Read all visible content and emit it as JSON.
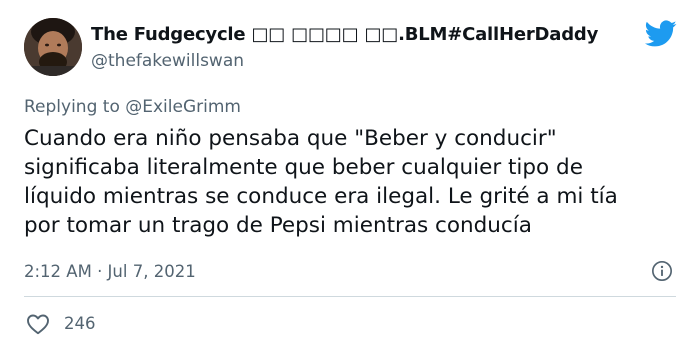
{
  "author": {
    "display_name": "The Fudgecycle □□ □□□□ □□.BLM#CallHerDaddy",
    "handle": "@thefakewillswan"
  },
  "reply": {
    "prefix": "Replying to",
    "mention": "@ExileGrimm"
  },
  "tweet": {
    "lines": [
      "Cuando era niño pensaba que \"Beber y conducir\"",
      "significaba literalmente que beber cualquier tipo de",
      "líquido mientras se conduce era ilegal. Le grité a mi tía",
      "por tomar un trago de Pepsi mientras conducía"
    ],
    "timestamp": "2:12 AM · Jul 7, 2021"
  },
  "stats": {
    "likes": "246"
  },
  "icons": {
    "brand": "twitter-bird-icon",
    "info": "info-icon",
    "like": "heart-icon"
  },
  "colors": {
    "brand_blue": "#1d9bf0",
    "text_primary": "#0f1419",
    "text_secondary": "#536471",
    "divider": "#cfd9de"
  }
}
